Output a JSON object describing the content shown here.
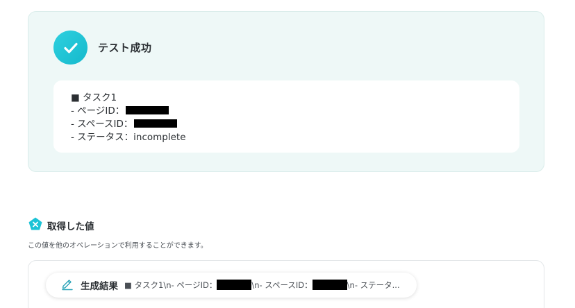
{
  "test_result": {
    "title": "テスト成功",
    "lines": {
      "task": "■ タスク1",
      "page_id_label": "- ページID：",
      "space_id_label": "- スペースID：",
      "status": "- ステータス：incomplete"
    }
  },
  "obtained_values": {
    "title": "取得した値",
    "description": "この値を他のオペレーションで利用することができます。",
    "items": [
      {
        "label": "生成結果",
        "value_part1": "■ タスク1\\n- ページID：",
        "value_part2": "\\n- スペースID：",
        "value_part3": "\\n- ステータ..."
      }
    ]
  },
  "colors": {
    "accent": "#1bc3d6",
    "card_bg": "#eef8f7"
  },
  "icons": {
    "success": "check-icon",
    "section": "pentagon-x-icon",
    "item": "pen-icon"
  }
}
